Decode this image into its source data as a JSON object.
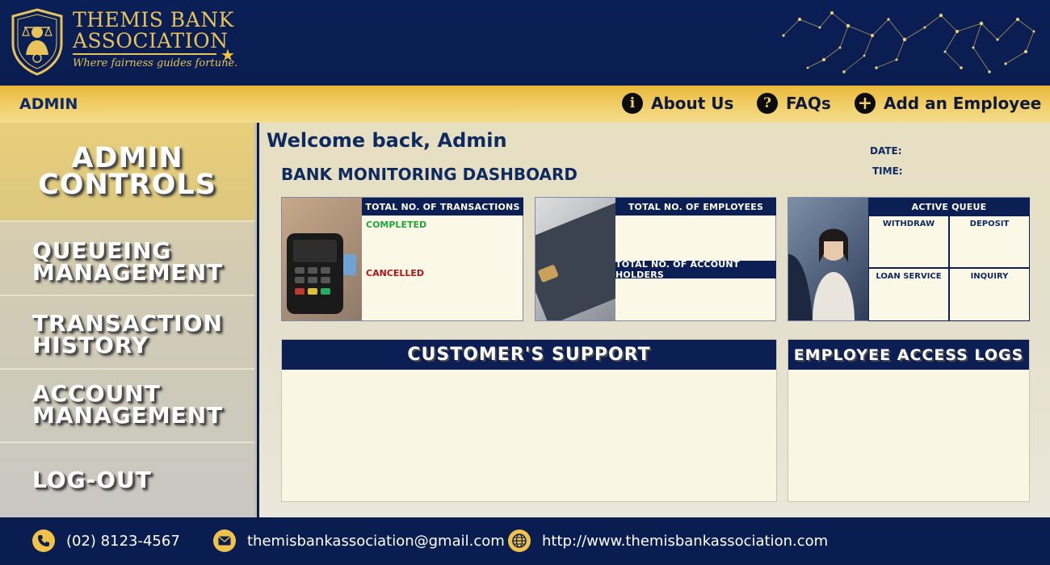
{
  "brand": {
    "line1": "THEMIS BANK",
    "line2": "ASSOCIATION",
    "tagline": "Where fairness guides fortune."
  },
  "nav": {
    "role": "ADMIN",
    "about": "About Us",
    "faqs": "FAQs",
    "add_employee": "Add an Employee"
  },
  "sidebar": {
    "title_line1": "ADMIN",
    "title_line2": "CONTROLS",
    "items": [
      {
        "line1": "QUEUEING",
        "line2": "MANAGEMENT"
      },
      {
        "line1": "TRANSACTION",
        "line2": "HISTORY"
      },
      {
        "line1": "ACCOUNT",
        "line2": "MANAGEMENT"
      },
      {
        "line1": "LOG-OUT",
        "line2": ""
      }
    ]
  },
  "main": {
    "welcome": "Welcome back, Admin",
    "dashboard_title": "BANK MONITORING DASHBOARD",
    "date_label": "DATE:",
    "time_label": "TIME:",
    "transactions": {
      "header": "TOTAL NO. OF TRANSACTIONS",
      "completed": "COMPLETED",
      "cancelled": "CANCELLED"
    },
    "employees": {
      "header": "TOTAL NO. OF EMPLOYEES",
      "account_holders_header": "TOTAL NO. OF ACCOUNT HOLDERS"
    },
    "queue": {
      "header": "ACTIVE QUEUE",
      "withdraw": "WITHDRAW",
      "deposit": "DEPOSIT",
      "loan": "LOAN SERVICE",
      "inquiry": "INQUIRY"
    },
    "support_title": "CUSTOMER'S SUPPORT",
    "logs_title": "EMPLOYEE ACCESS LOGS"
  },
  "footer": {
    "phone": "(02) 8123-4567",
    "email": "themisbankassociation@gmail.com",
    "website": "http://www.themisbankassociation.com"
  },
  "colors": {
    "navy": "#0a1d50",
    "gold": "#e9b93a",
    "cream": "#fbf8e8"
  }
}
